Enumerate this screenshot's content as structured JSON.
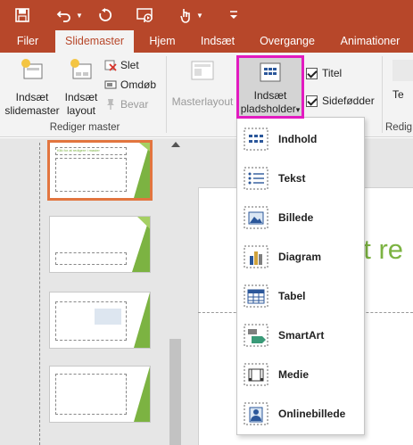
{
  "qat": {
    "icons": [
      "save-icon",
      "undo-icon",
      "undo-dropdown-icon",
      "redo-icon",
      "start-from-beginning-icon",
      "touch-mode-icon",
      "touch-dropdown-icon",
      "customize-qat-icon"
    ]
  },
  "tabs": [
    {
      "label": "Filer",
      "active": false
    },
    {
      "label": "Slidemaster",
      "active": true
    },
    {
      "label": "Hjem",
      "active": false
    },
    {
      "label": "Indsæt",
      "active": false
    },
    {
      "label": "Overgange",
      "active": false
    },
    {
      "label": "Animationer",
      "active": false
    }
  ],
  "ribbon": {
    "insert_slidemaster": {
      "line1": "Indsæt",
      "line2": "slidemaster"
    },
    "insert_layout": {
      "line1": "Indsæt",
      "line2": "layout"
    },
    "delete": "Slet",
    "rename": "Omdøb",
    "preserve": "Bevar",
    "group_label": "Rediger master",
    "master_layout": "Masterlayout",
    "insert_placeholder": {
      "line1": "Indsæt",
      "line2": "pladsholder",
      "arrow": "▾"
    },
    "title_check": {
      "label": "Titel",
      "checked": true
    },
    "footer_check": {
      "label": "Sidefødder",
      "checked": true
    },
    "theme_fragment": "Te",
    "group_label_right_fragment": "Redig"
  },
  "menu": {
    "items": [
      {
        "label": "Indhold",
        "icon": "content-placeholder-icon"
      },
      {
        "label": "Tekst",
        "icon": "text-placeholder-icon"
      },
      {
        "label": "Billede",
        "icon": "picture-placeholder-icon"
      },
      {
        "label": "Diagram",
        "icon": "chart-placeholder-icon"
      },
      {
        "label": "Tabel",
        "icon": "table-placeholder-icon"
      },
      {
        "label": "SmartArt",
        "icon": "smartart-placeholder-icon"
      },
      {
        "label": "Medie",
        "icon": "media-placeholder-icon"
      },
      {
        "label": "Onlinebillede",
        "icon": "online-picture-placeholder-icon"
      }
    ]
  },
  "slide": {
    "title_fragment": "at re",
    "thumb_title": "Klik for at redigere i master"
  },
  "colors": {
    "accent": "#b7472a",
    "highlight": "#e21bc0",
    "slide_green": "#7cb342",
    "selected_thumb": "#e2753f"
  }
}
